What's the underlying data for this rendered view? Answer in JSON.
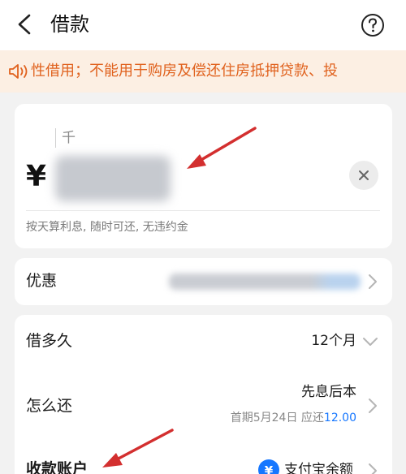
{
  "header": {
    "title": "借款"
  },
  "notice": {
    "text": "性借用；不能用于购房及偿还住房抵押贷款、投"
  },
  "amount_card": {
    "unit_label": "千",
    "currency_symbol": "¥",
    "hint": "按天算利息, 随时可还, 无违约金"
  },
  "discount": {
    "label": "优惠"
  },
  "term": {
    "label": "借多久",
    "value": "12个月"
  },
  "repayment": {
    "label": "怎么还",
    "value": "先息后本",
    "detail_prefix": "首期5月24日 应还",
    "detail_amount": "12.00"
  },
  "account": {
    "label": "收款账户",
    "value": "支付宝余额"
  },
  "colors": {
    "accent": "#1677ff",
    "notice_text": "#e0621e",
    "notice_bg": "#fcefe3",
    "annotation_arrow": "#d32f2f"
  }
}
